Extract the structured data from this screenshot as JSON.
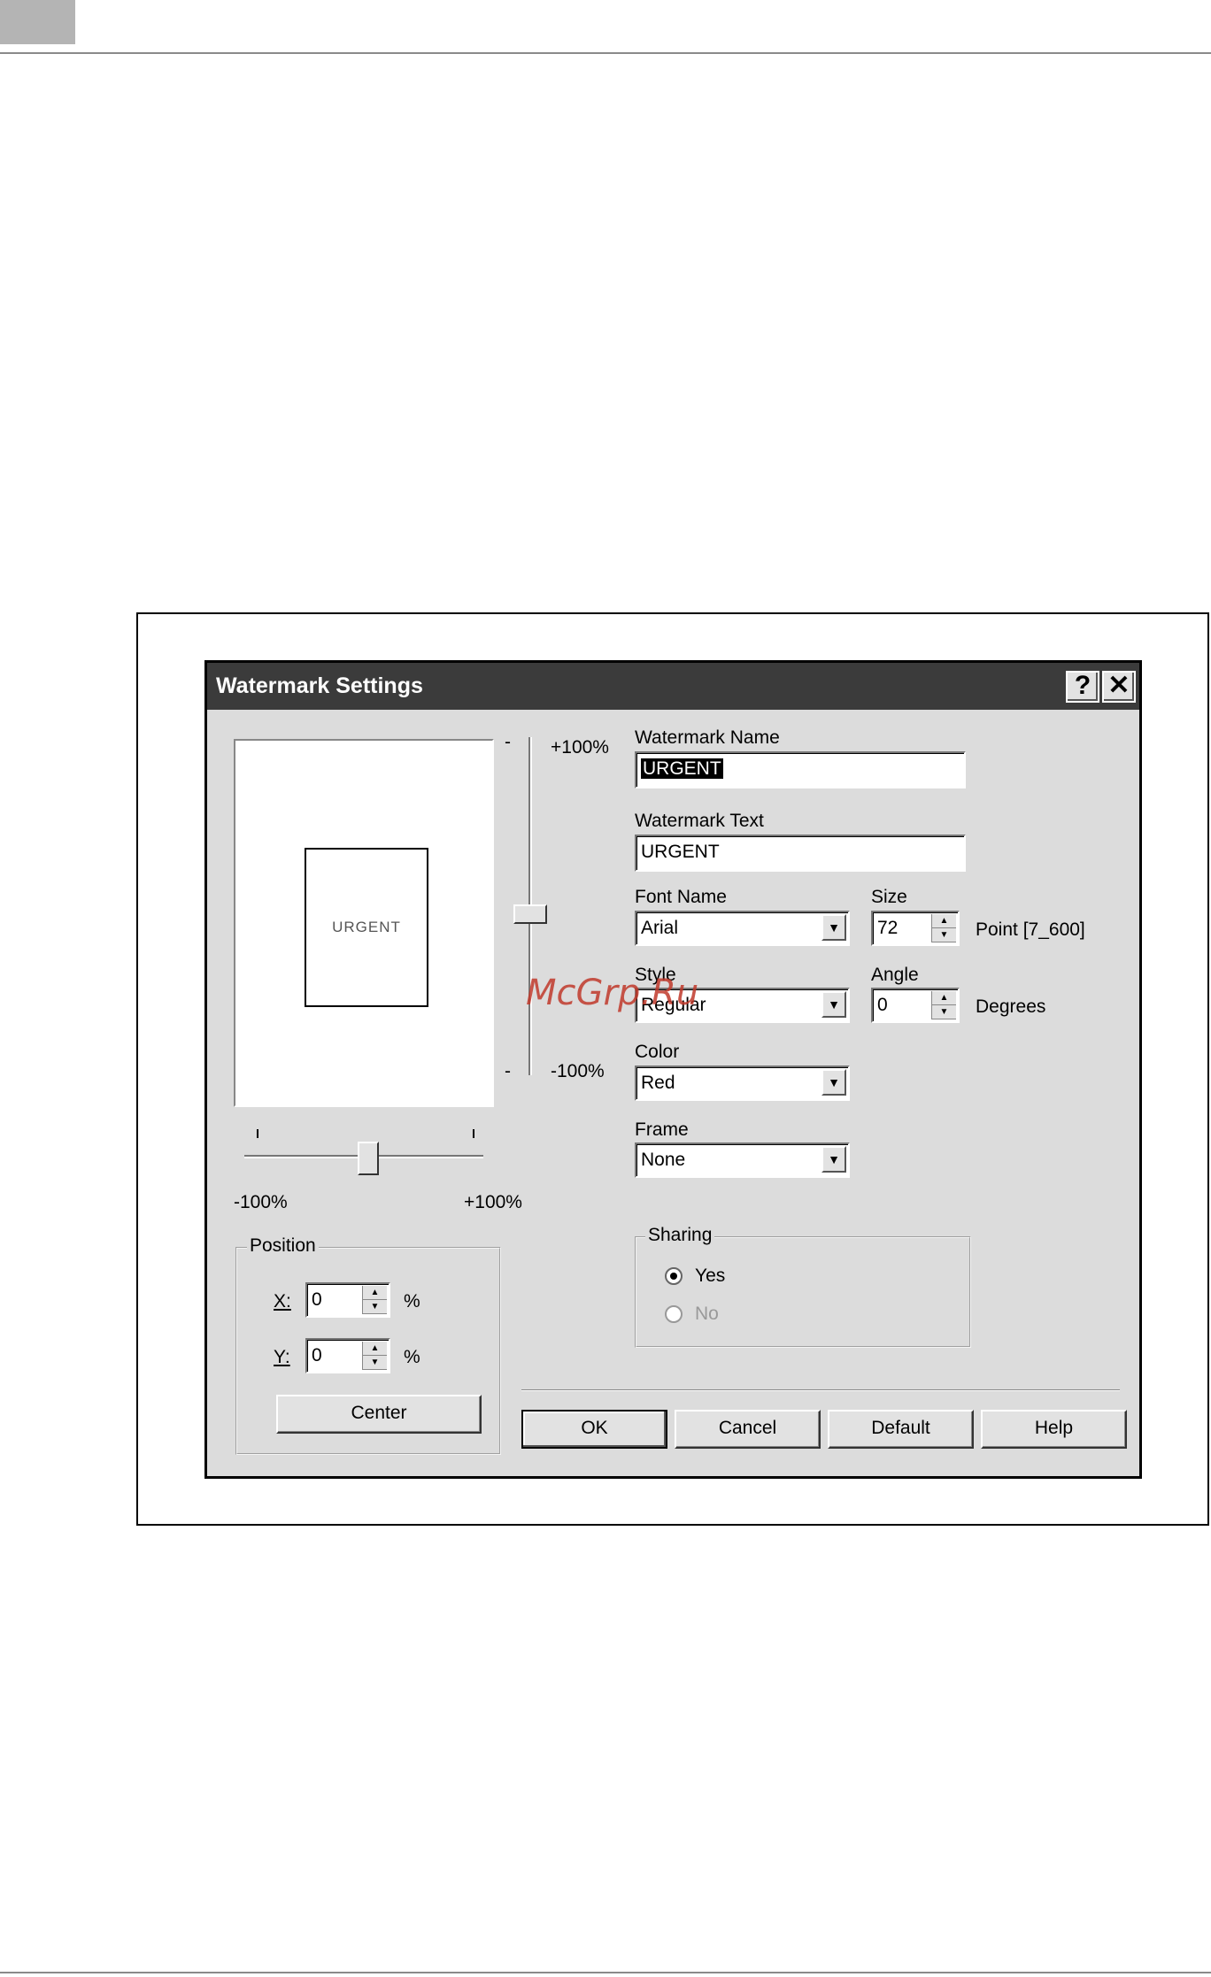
{
  "dialog": {
    "title": "Watermark Settings",
    "help_button": "?",
    "close_button": "✕"
  },
  "preview": {
    "sample_text": "URGENT",
    "vslider_top_label": "+100%",
    "vslider_bottom_label": "-100%",
    "vslider_top_tick": "-",
    "vslider_bottom_tick": "-",
    "hslider_left_label": "-100%",
    "hslider_right_label": "+100%"
  },
  "position": {
    "title": "Position",
    "x_label": "X:",
    "x_value": "0",
    "x_unit": "%",
    "y_label": "Y:",
    "y_value": "0",
    "y_unit": "%",
    "center_button": "Center"
  },
  "form": {
    "name_label": "Watermark Name",
    "name_value": "URGENT",
    "text_label": "Watermark Text",
    "text_value": "URGENT",
    "font_label": "Font Name",
    "font_value": "Arial",
    "size_label": "Size",
    "size_value": "72",
    "size_unit": "Point [7_600]",
    "style_label": "Style",
    "style_value": "Regular",
    "angle_label": "Angle",
    "angle_value": "0",
    "angle_unit": "Degrees",
    "color_label": "Color",
    "color_value": "Red",
    "frame_label": "Frame",
    "frame_value": "None"
  },
  "sharing": {
    "title": "Sharing",
    "yes_label": "Yes",
    "no_label": "No",
    "selected": "Yes"
  },
  "buttons": {
    "ok": "OK",
    "cancel": "Cancel",
    "default": "Default",
    "help": "Help"
  },
  "overlay_watermark": "McGrp.Ru",
  "icons": {
    "dropdown": "chevron-down-icon",
    "spin_up": "spin-up-icon",
    "spin_down": "spin-down-icon"
  }
}
